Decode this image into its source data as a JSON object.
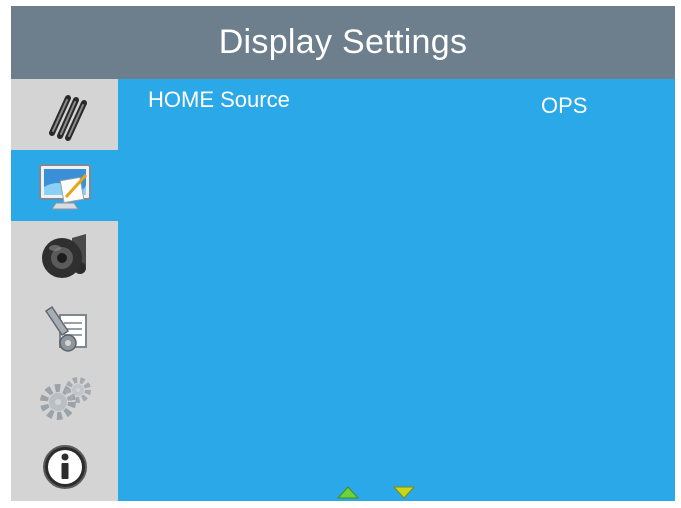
{
  "window": {
    "title": "Display Settings"
  },
  "sidebar": {
    "items": [
      {
        "icon": "pens-icon",
        "active": false
      },
      {
        "icon": "display-monitor-icon",
        "active": true
      },
      {
        "icon": "audio-speaker-icon",
        "active": false
      },
      {
        "icon": "tools-settings-icon",
        "active": false
      },
      {
        "icon": "gears-icon",
        "active": false
      },
      {
        "icon": "info-icon",
        "active": false
      }
    ]
  },
  "settings": {
    "rows": [
      {
        "label": "HOME Source",
        "value": "OPS"
      }
    ]
  },
  "nav": {
    "up_icon": "up-arrow-icon",
    "down_icon": "down-arrow-icon"
  },
  "colors": {
    "title_bar": "#6d7f8c",
    "panel": "#2aa8e8",
    "sidebar": "#d4d4d4",
    "arrow_up": "#6ed23a",
    "arrow_down": "#c8d818"
  }
}
